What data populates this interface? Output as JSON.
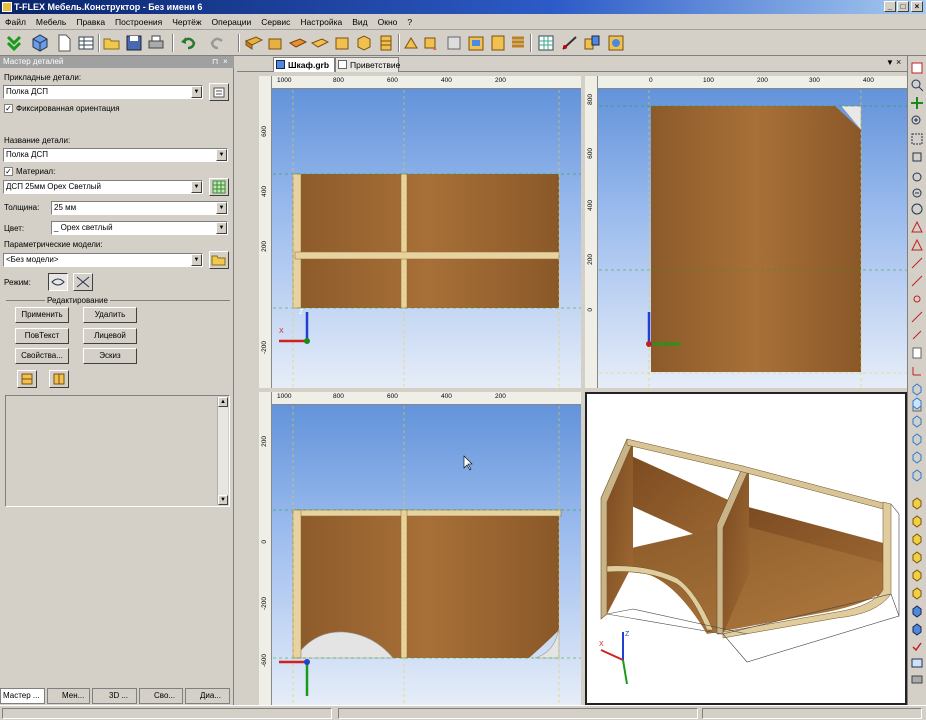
{
  "window": {
    "title": "T-FLEX Мебель.Конструктор - Без имени 6"
  },
  "menu": [
    "Файл",
    "Мебель",
    "Правка",
    "Построения",
    "Чертёж",
    "Операции",
    "Сервис",
    "Настройка",
    "Вид",
    "Окно",
    "?"
  ],
  "panel": {
    "title": "Мастер деталей",
    "applied_parts_label": "Прикладные детали:",
    "applied_parts_value": "Полка ДСП",
    "fixed_orientation_label": "Фиксированная ориентация",
    "fixed_orientation_checked": true,
    "part_name_label": "Название детали:",
    "part_name_value": "Полка ДСП",
    "material_label": "Материал:",
    "material_checked": true,
    "material_value": "ДСП 25мм Орех Светлый",
    "thickness_label": "Толщина:",
    "thickness_value": "25 мм",
    "color_label": "Цвет:",
    "color_value": "_ Орех светлый",
    "param_models_label": "Параметрические модели:",
    "param_models_value": "<Без модели>",
    "mode_label": "Режим:",
    "editing_group": "Редактирование",
    "buttons": {
      "apply": "Применить",
      "delete": "Удалить",
      "pov_text": "ПовТекст",
      "face": "Лицевой",
      "properties": "Свойства...",
      "sketch": "Эскиз"
    }
  },
  "bottom_tabs": [
    "Мастер ...",
    "Мен...",
    "3D ...",
    "Сво...",
    "Диа..."
  ],
  "doc_tabs": [
    "Шкаф.grb",
    "Приветствие"
  ],
  "viewports": {
    "top_left": {
      "ruler_h": [
        "1000",
        "800",
        "600",
        "400",
        "200"
      ],
      "ruler_v": [
        "600",
        "400",
        "200",
        "-200"
      ]
    },
    "top_right": {
      "ruler_h": [
        "0",
        "100",
        "200",
        "300",
        "400"
      ],
      "ruler_v": [
        "800",
        "600",
        "400",
        "200",
        "0"
      ]
    },
    "bottom_left": {
      "ruler_h": [
        "1000",
        "800",
        "600",
        "400",
        "200"
      ],
      "ruler_v": [
        "200",
        "0",
        "-200",
        "-600"
      ]
    }
  },
  "colors": {
    "title_start": "#0a246a",
    "viewport_sky": "#5d8fd8",
    "wood": "#9a6a36",
    "axis_x": "#d02020",
    "axis_y": "#20a020",
    "axis_z": "#2040d0"
  }
}
